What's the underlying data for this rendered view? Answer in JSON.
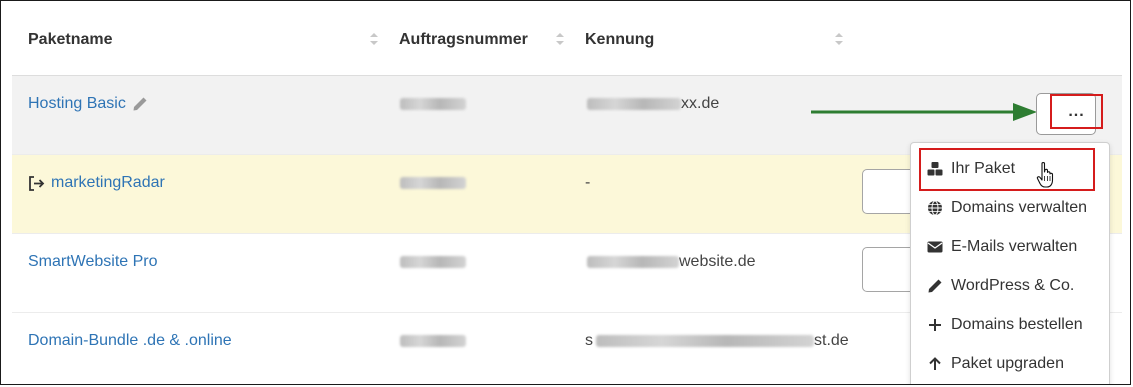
{
  "table": {
    "columns": [
      {
        "label": "Paketname"
      },
      {
        "label": "Auftragsnummer"
      },
      {
        "label": "Kennung"
      }
    ],
    "rows": [
      {
        "name": "Hosting Basic",
        "kennung_visible": "xx.de"
      },
      {
        "name": "marketingRadar",
        "kennung_visible": "-"
      },
      {
        "name": "SmartWebsite Pro",
        "kennung_visible": "website.de"
      },
      {
        "name": "Domain-Bundle .de & .online",
        "kennung_prefix": "s",
        "kennung_visible": "st.de"
      }
    ]
  },
  "actions_button": {
    "label": "..."
  },
  "dropdown": {
    "items": [
      {
        "label": "Ihr Paket",
        "icon": "cubes-icon"
      },
      {
        "label": "Domains verwalten",
        "icon": "globe-icon"
      },
      {
        "label": "E-Mails verwalten",
        "icon": "envelope-icon"
      },
      {
        "label": "WordPress & Co.",
        "icon": "pencil-icon"
      },
      {
        "label": "Domains bestellen",
        "icon": "plus-icon"
      },
      {
        "label": "Paket upgraden",
        "icon": "arrow-up-icon"
      }
    ]
  },
  "colors": {
    "link": "#2e74b5",
    "highlight_red": "#d51c1c",
    "arrow_green": "#2e7d32",
    "row_selected": "#f2f2f2",
    "row_yellow": "#fcf8d9"
  }
}
